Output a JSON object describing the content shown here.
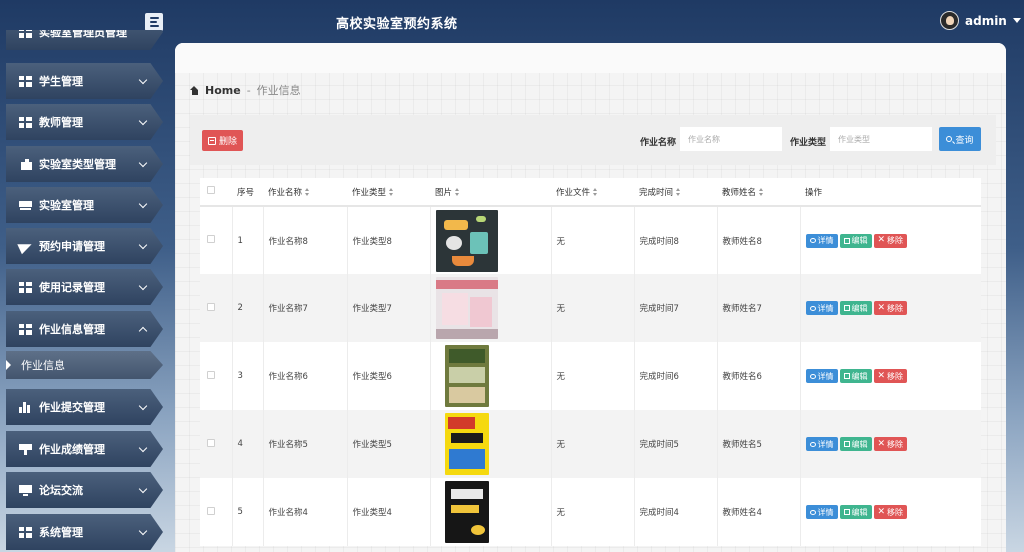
{
  "header": {
    "app_title": "高校实验室预约系统",
    "user_name": "admin"
  },
  "sidebar": {
    "items": [
      {
        "label": "实验室管理员管理",
        "icon": "grid-icon"
      },
      {
        "label": "学生管理",
        "icon": "grid-icon"
      },
      {
        "label": "教师管理",
        "icon": "grid-icon"
      },
      {
        "label": "实验室类型管理",
        "icon": "tag-icon"
      },
      {
        "label": "实验室管理",
        "icon": "drive-icon"
      },
      {
        "label": "预约申请管理",
        "icon": "paper-plane-icon"
      },
      {
        "label": "使用记录管理",
        "icon": "grid-icon"
      },
      {
        "label": "作业信息管理",
        "icon": "grid-icon"
      },
      {
        "label": "作业提交管理",
        "icon": "bar-chart-icon"
      },
      {
        "label": "作业成绩管理",
        "icon": "stamp-icon"
      },
      {
        "label": "论坛交流",
        "icon": "monitor-icon"
      },
      {
        "label": "系统管理",
        "icon": "grid-icon"
      }
    ],
    "active_sub_item": "作业信息"
  },
  "breadcrumb": {
    "home": "Home",
    "separator": "-",
    "current": "作业信息"
  },
  "toolbar": {
    "delete_label": "删除",
    "name_label": "作业名称",
    "name_placeholder": "作业名称",
    "type_label": "作业类型",
    "type_placeholder": "作业类型",
    "search_label": "查询"
  },
  "table": {
    "columns": [
      "序号",
      "作业名称",
      "作业类型",
      "图片",
      "作业文件",
      "完成时间",
      "教师姓名",
      "操作"
    ],
    "rows": [
      {
        "index": "1",
        "name": "作业名称8",
        "type": "作业类型8",
        "file": "无",
        "time": "完成时间8",
        "teacher": "教师姓名8",
        "image": "science-lab-illustration"
      },
      {
        "index": "2",
        "name": "作业名称7",
        "type": "作业类型7",
        "file": "无",
        "time": "完成时间7",
        "teacher": "教师姓名7",
        "image": "book-cover-pink"
      },
      {
        "index": "3",
        "name": "作业名称6",
        "type": "作业类型6",
        "file": "无",
        "time": "完成时间6",
        "teacher": "教师姓名6",
        "image": "book-cover-green"
      },
      {
        "index": "4",
        "name": "作业名称5",
        "type": "作业类型5",
        "file": "无",
        "time": "完成时间5",
        "teacher": "教师姓名5",
        "image": "book-cover-yellow"
      },
      {
        "index": "5",
        "name": "作业名称4",
        "type": "作业类型4",
        "file": "无",
        "time": "完成时间4",
        "teacher": "教师姓名4",
        "image": "book-cover-dark"
      }
    ],
    "actions": {
      "detail": "详情",
      "edit": "编辑",
      "remove": "移除"
    }
  },
  "colors": {
    "primary": "#3c8ed8",
    "success": "#3fb58f",
    "danger": "#e05555",
    "sidebar": "#2f4360"
  }
}
